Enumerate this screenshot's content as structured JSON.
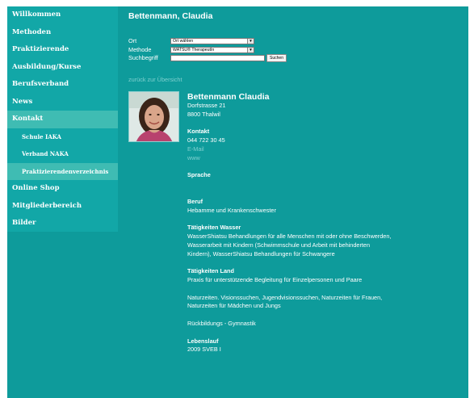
{
  "sidebar": {
    "items": [
      {
        "label": "Willkommen"
      },
      {
        "label": "Methoden"
      },
      {
        "label": "Praktizierende"
      },
      {
        "label": "Ausbildung/Kurse"
      },
      {
        "label": "Berufsverband"
      },
      {
        "label": "News"
      },
      {
        "label": "Kontakt"
      }
    ],
    "subitems": [
      {
        "label": "Schule IAKA"
      },
      {
        "label": "Verband NAKA"
      },
      {
        "label": "Praktizierendenverzeichnis"
      }
    ],
    "items2": [
      {
        "label": "Online Shop"
      },
      {
        "label": "Mitgliederbereich"
      },
      {
        "label": "Bilder"
      }
    ]
  },
  "main": {
    "title": "Bettenmann, Claudia",
    "form": {
      "ort_label": "Ort",
      "ort_value": "Ort wählen",
      "methode_label": "Methode",
      "methode_value": "WATSU® TherapeutIn",
      "suchbegriff_label": "Suchbegriff",
      "suchbegriff_value": "",
      "search_button": "Suchen"
    },
    "back_link": "zurück zur Übersicht"
  },
  "profile": {
    "name": "Bettenmann Claudia",
    "street": "Dorfstrasse 21",
    "city": "8800 Thalwil",
    "kontakt_head": "Kontakt",
    "phone": "044 722 30 45",
    "email": "E-Mail",
    "web": "www",
    "sprache_head": "Sprache",
    "beruf_head": "Beruf",
    "beruf": "Hebamme und Krankenschwester",
    "wasser_head": "Tätigkeiten Wasser",
    "wasser_1": "WasserShiatsu Behandlungen für alle Menschen mit oder ohne Beschwerden,",
    "wasser_2": "Wasserarbeit mit Kindern (Schwimmschule und Arbeit mit behinderten",
    "wasser_3": "Kindern), WasserShiatsu Behandlungen für Schwangere",
    "land_head": "Tätigkeiten Land",
    "land_1": "Praxis für unterstützende Begleitung für Einzelpersonen und Paare",
    "land_2": "Naturzeiten. Visionssuchen, Jugendvisionssuchen, Naturzeiten für Frauen,",
    "land_3": "Naturzeiten für Mädchen und Jungs",
    "land_4": "Rückbildungs - Gymnastik",
    "lebenslauf_head": "Lebenslauf",
    "lebenslauf_1": "2009 SVEB I"
  }
}
